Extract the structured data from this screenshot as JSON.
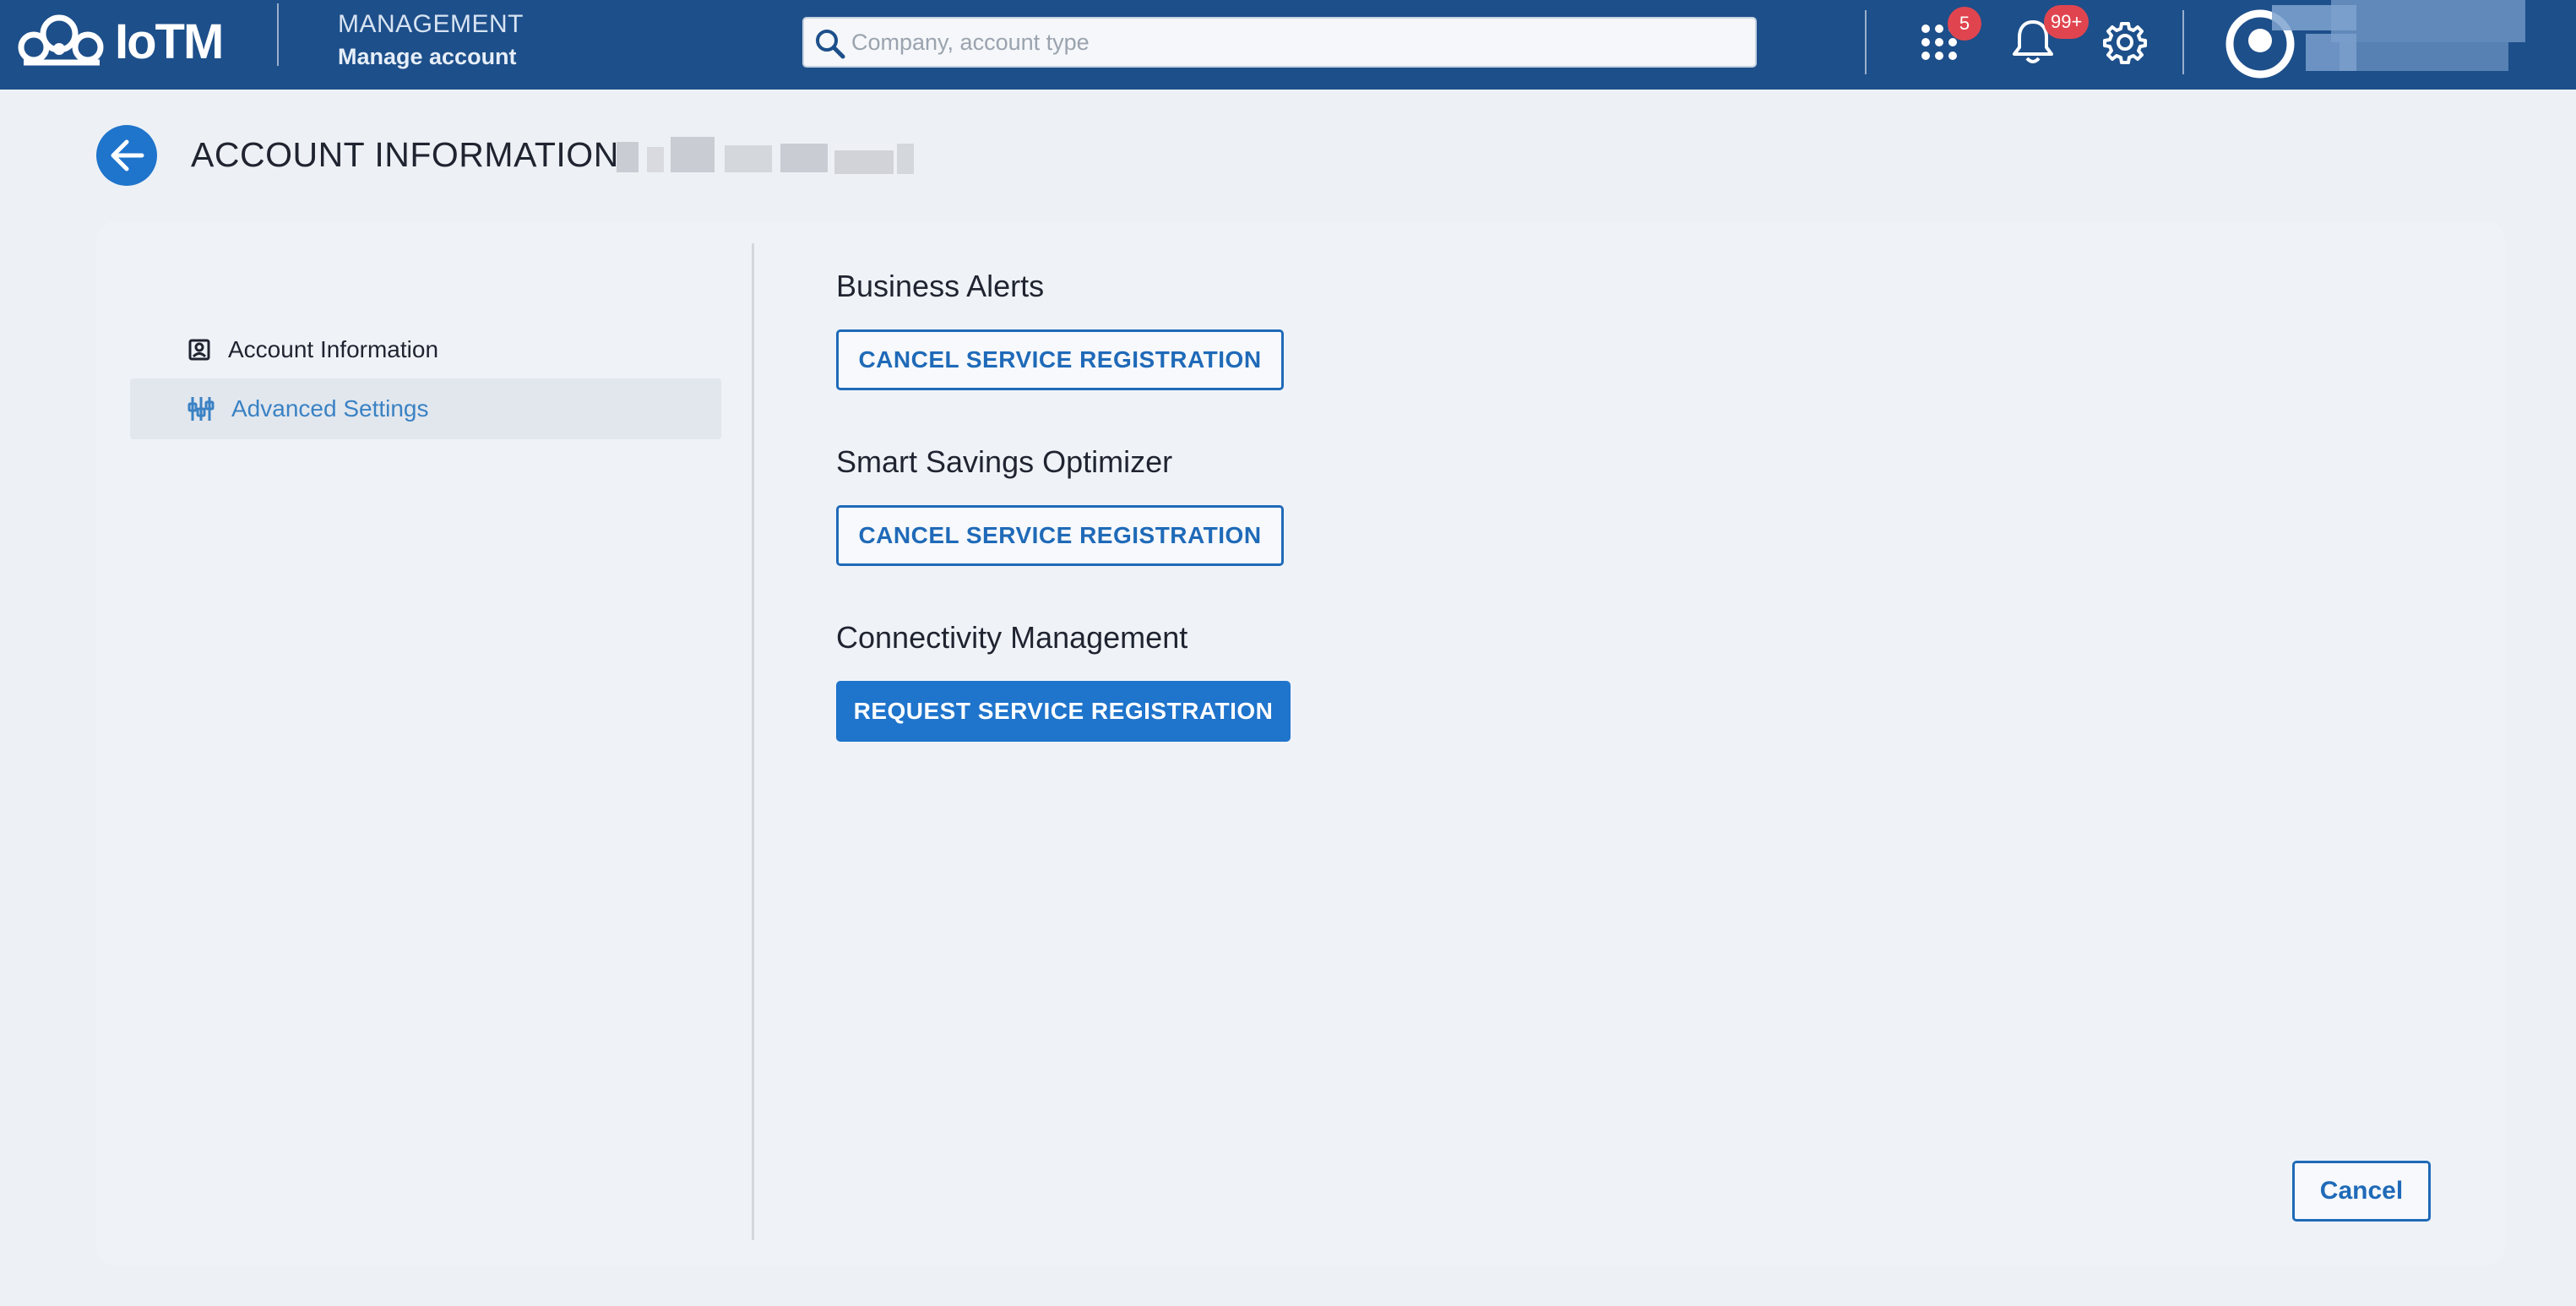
{
  "header": {
    "logo_text": "IoTM",
    "module_title": "MANAGEMENT",
    "module_subtitle": "Manage account",
    "search_placeholder": "Company, account type",
    "apps_badge": "5",
    "notifications_badge": "99+"
  },
  "page": {
    "title": "ACCOUNT INFORMATION:"
  },
  "sidebar": {
    "items": [
      {
        "label": "Account Information",
        "icon": "account-box-icon",
        "active": false
      },
      {
        "label": "Advanced Settings",
        "icon": "sliders-icon",
        "active": true
      }
    ]
  },
  "services": [
    {
      "name": "Business Alerts",
      "action": "CANCEL SERVICE REGISTRATION"
    },
    {
      "name": "Smart Savings Optimizer",
      "action": "CANCEL SERVICE REGISTRATION"
    },
    {
      "name": "Connectivity Management",
      "action": "REQUEST SERVICE REGISTRATION"
    }
  ],
  "footer": {
    "cancel_label": "Cancel"
  },
  "colors": {
    "topbar": "#1d4f8a",
    "accent": "#1f74cc",
    "badge": "#e0454f",
    "background": "#edf1f5"
  }
}
